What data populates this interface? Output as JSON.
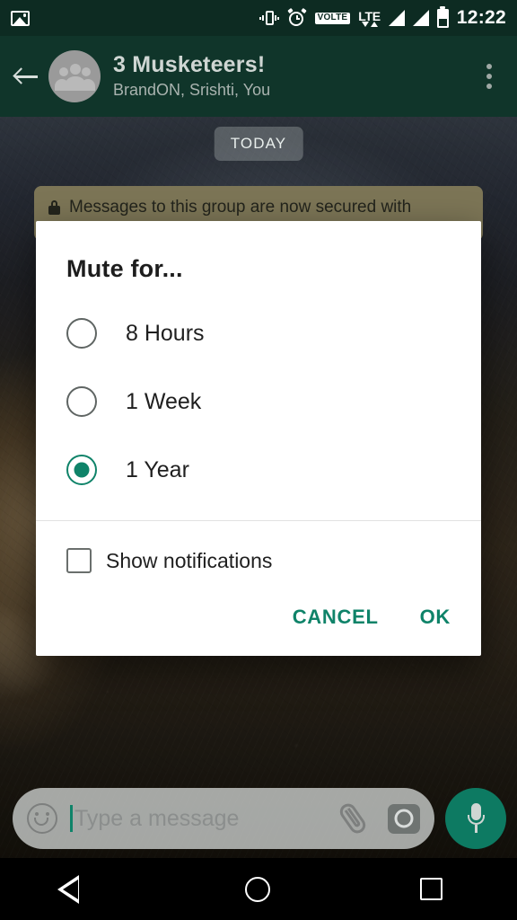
{
  "statusbar": {
    "image_icon": "image-icon",
    "vibrate_icon": "vibrate-icon",
    "alarm_icon": "alarm-icon",
    "volte_label": "VOLTE",
    "lte_label": "LTE",
    "signal_icon": "signal-bars-icon",
    "battery_icon": "battery-icon",
    "time": "12:22"
  },
  "toolbar": {
    "back_icon": "back-arrow-icon",
    "avatar": "group-avatar",
    "title": "3 Musketeers!",
    "subtitle": "BrandON, Srishti, You",
    "overflow_icon": "overflow-menu-icon"
  },
  "chat": {
    "date_badge": "TODAY",
    "encryption_notice": "Messages to this group are now secured with",
    "lock_icon": "lock-icon"
  },
  "dialog": {
    "title": "Mute for...",
    "options": [
      {
        "label": "8 Hours",
        "selected": false
      },
      {
        "label": "1 Week",
        "selected": false
      },
      {
        "label": "1 Year",
        "selected": true
      }
    ],
    "checkbox": {
      "label": "Show notifications",
      "checked": false
    },
    "cancel_label": "CANCEL",
    "ok_label": "OK",
    "accent_color": "#0f8369"
  },
  "input": {
    "emoji_icon": "emoji-icon",
    "placeholder": "Type a message",
    "attach_icon": "paperclip-icon",
    "camera_icon": "camera-icon",
    "mic_icon": "microphone-icon"
  },
  "navbar": {
    "back": "nav-back-icon",
    "home": "nav-home-icon",
    "recents": "nav-recents-icon"
  }
}
